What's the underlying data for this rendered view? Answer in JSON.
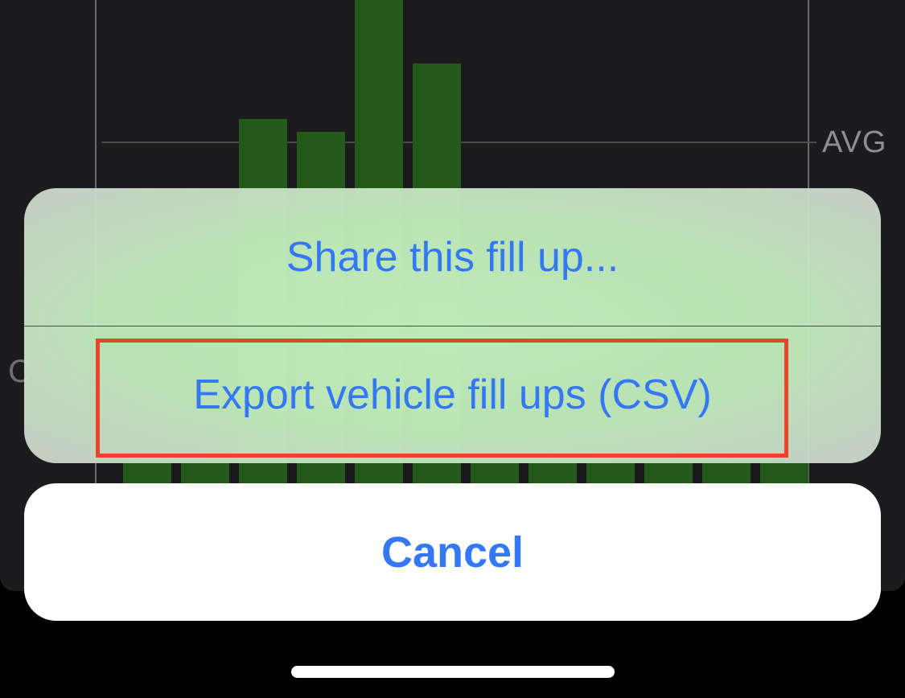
{
  "background_chart": {
    "avg_label": "AVG",
    "side_glyph": "C",
    "bar_color": "#255a1a",
    "grid_color": "#6a6a6a"
  },
  "action_sheet": {
    "items": [
      {
        "label": "Share this fill up..."
      },
      {
        "label": "Export vehicle fill ups (CSV)"
      }
    ],
    "cancel_label": "Cancel",
    "highlight_color": "#e8442a",
    "text_color": "#3478f6"
  }
}
